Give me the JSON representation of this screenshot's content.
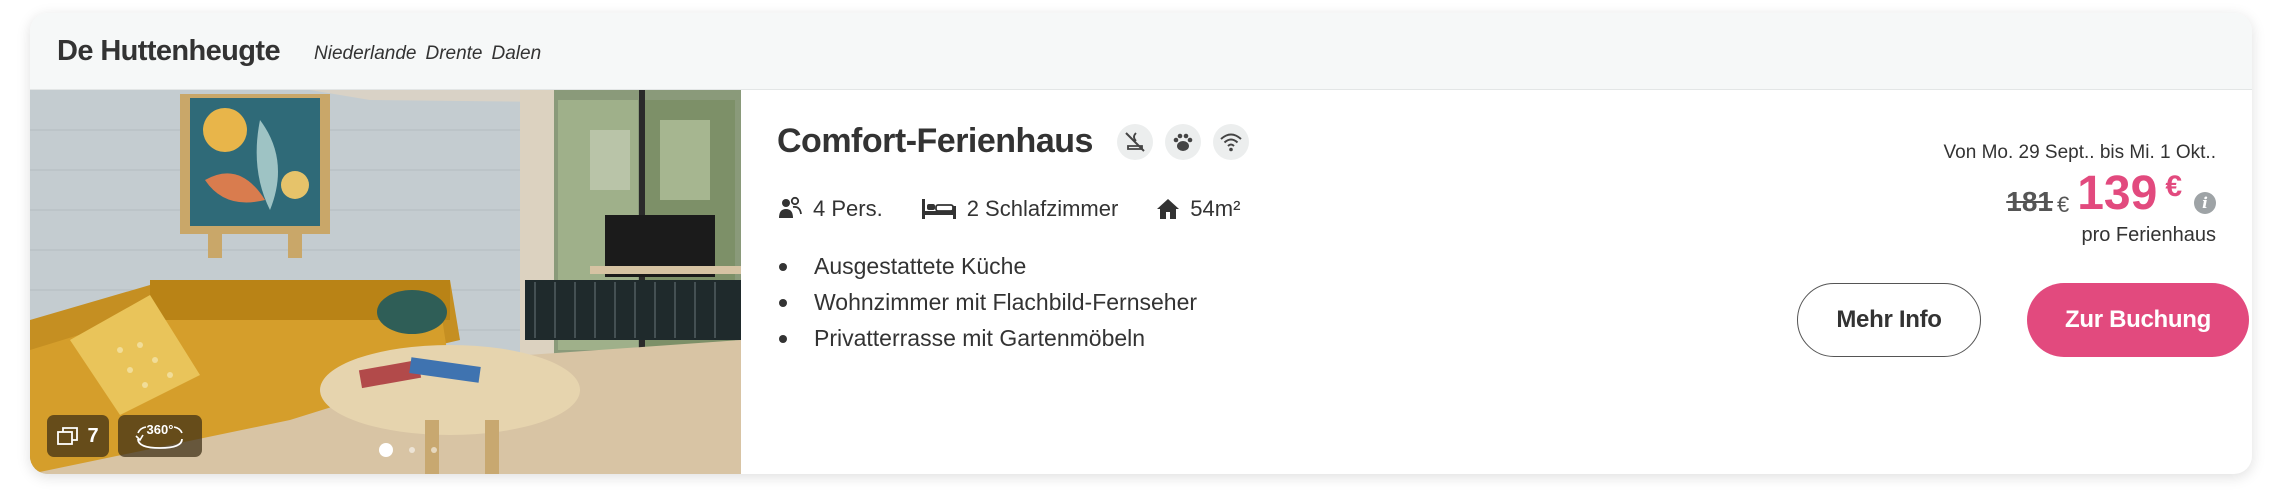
{
  "header": {
    "park_name": "De Huttenheugte",
    "location": [
      "Niederlande",
      "Drente",
      "Dalen"
    ]
  },
  "gallery": {
    "photo_count": "7",
    "tour_label": "360°",
    "slide_count": 3,
    "active_slide": 1
  },
  "accommodation": {
    "title": "Comfort-Ferienhaus",
    "feature_icons": [
      "no-smoking-icon",
      "pets-allowed-icon",
      "wifi-icon"
    ],
    "specs": {
      "persons": "4 Pers.",
      "bedrooms": "2 Schlafzimmer",
      "area": "54m²"
    },
    "highlights": [
      "Ausgestattete Küche",
      "Wohnzimmer mit Flachbild-Fernseher",
      "Privatterrasse mit Gartenmöbeln"
    ]
  },
  "pricing": {
    "dates": "Von Mo. 29 Sept.. bis Mi. 1 Okt..",
    "old_price": "181",
    "old_currency": "€",
    "new_price": "139",
    "new_currency": "€",
    "info_symbol": "i",
    "per_unit": "pro Ferienhaus",
    "accent_color": "#e24a7e"
  },
  "actions": {
    "more_info_label": "Mehr Info",
    "book_label": "Zur Buchung"
  }
}
